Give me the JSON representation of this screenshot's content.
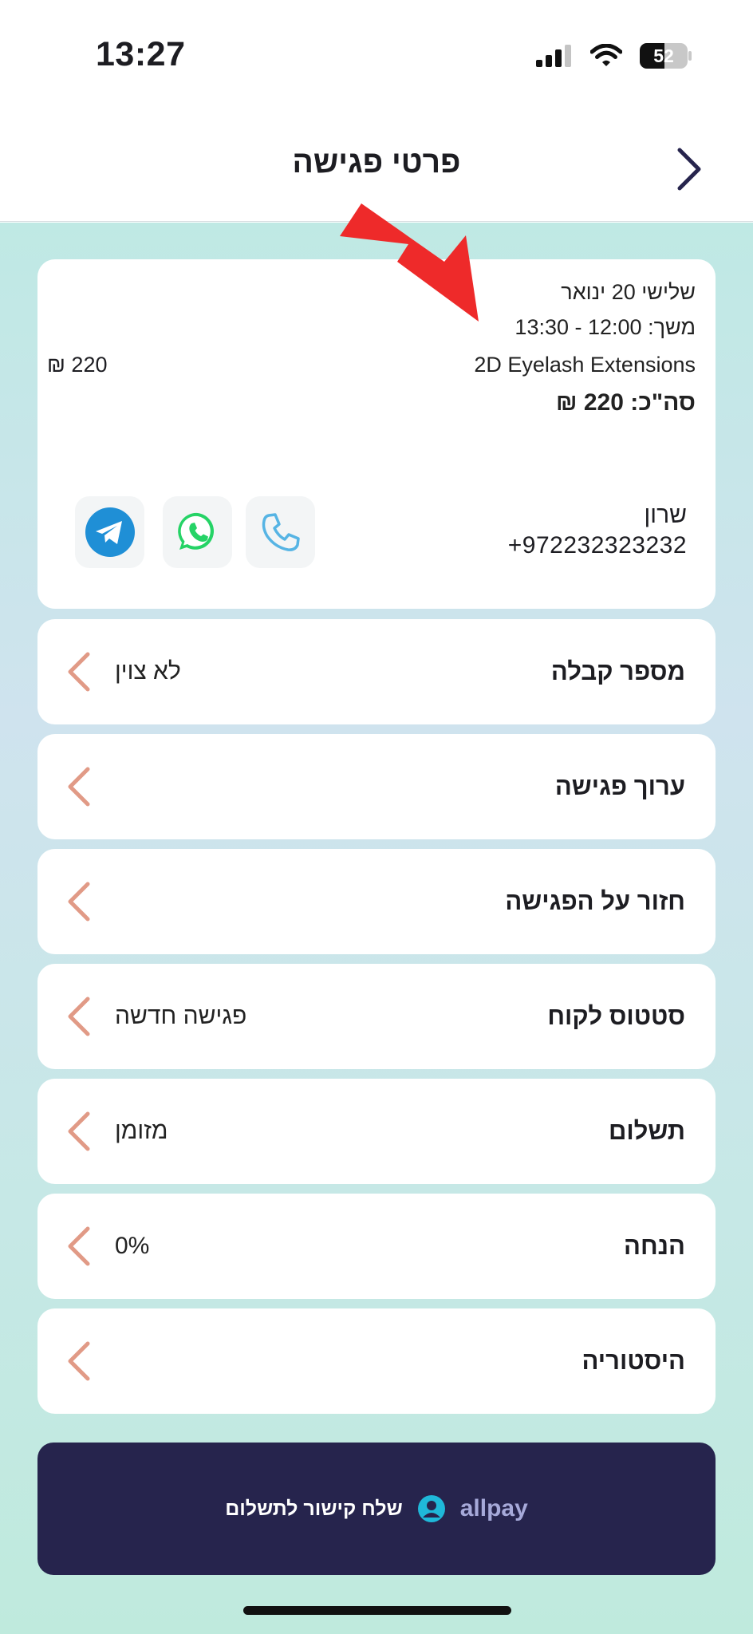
{
  "status_bar": {
    "time": "13:27",
    "battery": "52"
  },
  "nav": {
    "title": "פרטי פגישה",
    "back_icon": "chevron-right-icon"
  },
  "appointment": {
    "date": "שלישי 20 ינואר",
    "duration": "משך: 12:00 - 13:30",
    "service": "2D Eyelash Extensions",
    "service_price": "₪ 220",
    "total": "סה\"כ: 220 ₪"
  },
  "client": {
    "name": "שרון",
    "phone": "+972232323232",
    "contact_icons": [
      "telegram-icon",
      "whatsapp-icon",
      "phone-icon"
    ]
  },
  "rows": [
    {
      "label": "מספר קבלה",
      "value": "לא צוין"
    },
    {
      "label": "ערוך פגישה",
      "value": ""
    },
    {
      "label": "חזור על הפגישה",
      "value": ""
    },
    {
      "label": "סטטוס לקוח",
      "value": "פגישה חדשה"
    },
    {
      "label": "תשלום",
      "value": "מזומן"
    },
    {
      "label": "הנחה",
      "value": "0%"
    },
    {
      "label": "היסטוריה",
      "value": ""
    }
  ],
  "payment_button": {
    "label": "שלח קישור לתשלום",
    "brand": "allpay"
  },
  "colors": {
    "accent_dark": "#26244d",
    "chevron": "#e19a86",
    "whatsapp": "#25d366",
    "telegram": "#1f8fd6",
    "phone": "#56b4e4",
    "arrow": "#ee2a2a"
  }
}
